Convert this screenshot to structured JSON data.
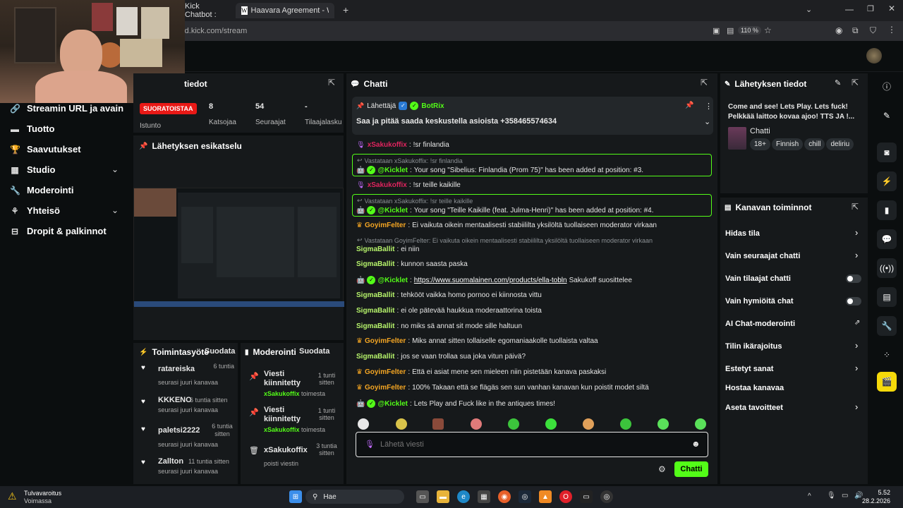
{
  "browser": {
    "tabs": [
      "Kick Chatbot :",
      "Haavara Agreement - Wikipedia"
    ],
    "url": "rd.kick.com/stream",
    "zoom": "110 %"
  },
  "sidebar": {
    "items": [
      {
        "label": "Streamin URL ja avain",
        "icon": "link-icon"
      },
      {
        "label": "Tuotto",
        "icon": "money-icon"
      },
      {
        "label": "Saavutukset",
        "icon": "trophy-icon"
      },
      {
        "label": "Studio",
        "icon": "studio-icon"
      },
      {
        "label": "Moderointi",
        "icon": "wrench-icon"
      },
      {
        "label": "Yhteisö",
        "icon": "community-icon"
      },
      {
        "label": "Dropit & palkinnot",
        "icon": "gift-icon"
      }
    ]
  },
  "session": {
    "title": "tiedot",
    "live_badge": "SUORATOISTAA",
    "live_label": "Istunto",
    "stats": [
      {
        "value": "8",
        "label": "Katsojaa"
      },
      {
        "value": "54",
        "label": "Seuraajat"
      },
      {
        "value": "-",
        "label": "Tilaajalasku"
      }
    ]
  },
  "preview": {
    "title": "Lähetyksen esikatselu"
  },
  "activity": {
    "title": "Toimintasyöte",
    "filter": "Suodata",
    "items": [
      {
        "user": "ratareiska",
        "action": "seurasi juuri kanavaa",
        "time": "6 tuntia sitten"
      },
      {
        "user": "KKKENO",
        "action": "seurasi juuri kanavaa",
        "time": "6 tuntia sitten"
      },
      {
        "user": "paletsi2222",
        "action": "seurasi juuri kanavaa",
        "time": "6 tuntia sitten"
      },
      {
        "user": "Zallton",
        "action": "seurasi juuri kanavaa",
        "time": "11 tuntia sitten"
      }
    ]
  },
  "moderation": {
    "title": "Moderointi",
    "filter": "Suodata",
    "items": [
      {
        "title": "Viesti kiinnitetty",
        "by": "xSakukoffix",
        "suffix": "toimesta",
        "time": "1 tunti sitten"
      },
      {
        "title": "Viesti kiinnitetty",
        "by": "xSakukoffix",
        "suffix": "toimesta",
        "time": "1 tunti sitten"
      },
      {
        "title": "xSakukoffix",
        "by": "",
        "suffix": "poisti viestin",
        "time": "3 tuntia sitten"
      }
    ]
  },
  "chat": {
    "title": "Chatti",
    "pinned": {
      "sender_label": "Lähettäjä",
      "sender": "BotRix",
      "text": "Saa ja pitää saada keskustella asioista +358465574634"
    },
    "messages": [
      {
        "type": "msg",
        "user": "xSakukoffix",
        "color": "#e0245e",
        "text": "!sr finlandia"
      },
      {
        "type": "bot",
        "reply": "Vastataan xSakukoffix: !sr finlandia",
        "user": "@Kicklet",
        "text": "Your song \"Sibelius: Finlandia (Prom 75)\" has been added at position: #3."
      },
      {
        "type": "msg",
        "user": "xSakukoffix",
        "color": "#e0245e",
        "text": "!sr teille kaikille"
      },
      {
        "type": "bot",
        "reply": "Vastataan xSakukoffix: !sr teille kaikille",
        "user": "@Kicklet",
        "text": "Your song \"Teille Kaikille (feat. Julma-Henri)\" has been added at position: #4."
      },
      {
        "type": "msg",
        "user": "GoyimFelter",
        "color": "#f5a623",
        "text": "Ei vaikuta oikein mentaalisesti stabiililta yksilöltä tuollaiseen moderator virkaan"
      },
      {
        "type": "reply",
        "reply": "Vastataan GoyimFelter: Ei vaikuta oikein mentaalisesti stabiililta yksilöltä tuollaiseen moderator virkaan",
        "user": "SigmaBallit",
        "color": "#b6f36b",
        "text": "ei niin"
      },
      {
        "type": "msg",
        "user": "SigmaBallit",
        "color": "#b6f36b",
        "text": "kunnon saasta paska"
      },
      {
        "type": "link",
        "user": "@Kicklet",
        "link": "https://www.suomalainen.com/products/ella-tobln",
        "text": "Sakukoff suosittelee"
      },
      {
        "type": "msg",
        "user": "SigmaBallit",
        "color": "#b6f36b",
        "text": "tehkööt vaikka homo pornoo ei kiinnosta vittu"
      },
      {
        "type": "msg",
        "user": "SigmaBallit",
        "color": "#b6f36b",
        "text": "ei ole pätevää haukkua moderaattorina toista"
      },
      {
        "type": "msg",
        "user": "SigmaBallit",
        "color": "#b6f36b",
        "text": "no miks sä annat sit mode sille haltuun"
      },
      {
        "type": "msg",
        "user": "GoyimFelter",
        "color": "#f5a623",
        "text": "Miks annat sitten tollaiselle egomaniaakolle tuollaista valtaa"
      },
      {
        "type": "msg",
        "user": "SigmaBallit",
        "color": "#b6f36b",
        "text": "jos se vaan trollaa sua joka vitun päivä?"
      },
      {
        "type": "msg",
        "user": "GoyimFelter",
        "color": "#f5a623",
        "text": "Että ei asiat mene sen mieleen niin pistetään kanava paskaksi"
      },
      {
        "type": "msg",
        "user": "GoyimFelter",
        "color": "#f5a623",
        "text": "100% Takaan että se flägäs sen sun vanhan kanavan kun poistit modet siltä"
      },
      {
        "type": "msg",
        "user": "@Kicklet",
        "color": "#53fc18",
        "text": "Lets Play and Fuck like in the antiques times!"
      }
    ],
    "input_placeholder": "Lähetä viesti",
    "send_label": "Chatti"
  },
  "stream_info": {
    "title": "Lähetyksen tiedot",
    "stream_title": "Come and see! Lets Play. Lets fuck! Pelkkää laittoo kovaa ajoo! TTS JA !...",
    "category": "Chatti",
    "tags": [
      "18+",
      "Finnish",
      "chill",
      "deliriu"
    ]
  },
  "channel_actions": {
    "title": "Kanavan toiminnot",
    "items": [
      {
        "label": "Hidas tila",
        "control": "chevron"
      },
      {
        "label": "Vain seuraajat chatti",
        "control": "chevron"
      },
      {
        "label": "Vain tilaajat chatti",
        "control": "toggle"
      },
      {
        "label": "Vain hymiöitä chat",
        "control": "toggle"
      },
      {
        "label": "AI Chat-moderointi",
        "control": "external"
      },
      {
        "label": "Tilin ikärajoitus",
        "control": "chevron"
      },
      {
        "label": "Estetyt sanat",
        "control": "chevron"
      },
      {
        "label": "Hostaa kanavaa",
        "control": "none"
      },
      {
        "label": "Aseta tavoitteet",
        "control": "chevron"
      }
    ]
  },
  "taskbar": {
    "weather_title": "Tulvavaroitus",
    "weather_sub": "Voimassa",
    "search": "Hae",
    "time": "5.52",
    "date": "28.2.2026"
  }
}
